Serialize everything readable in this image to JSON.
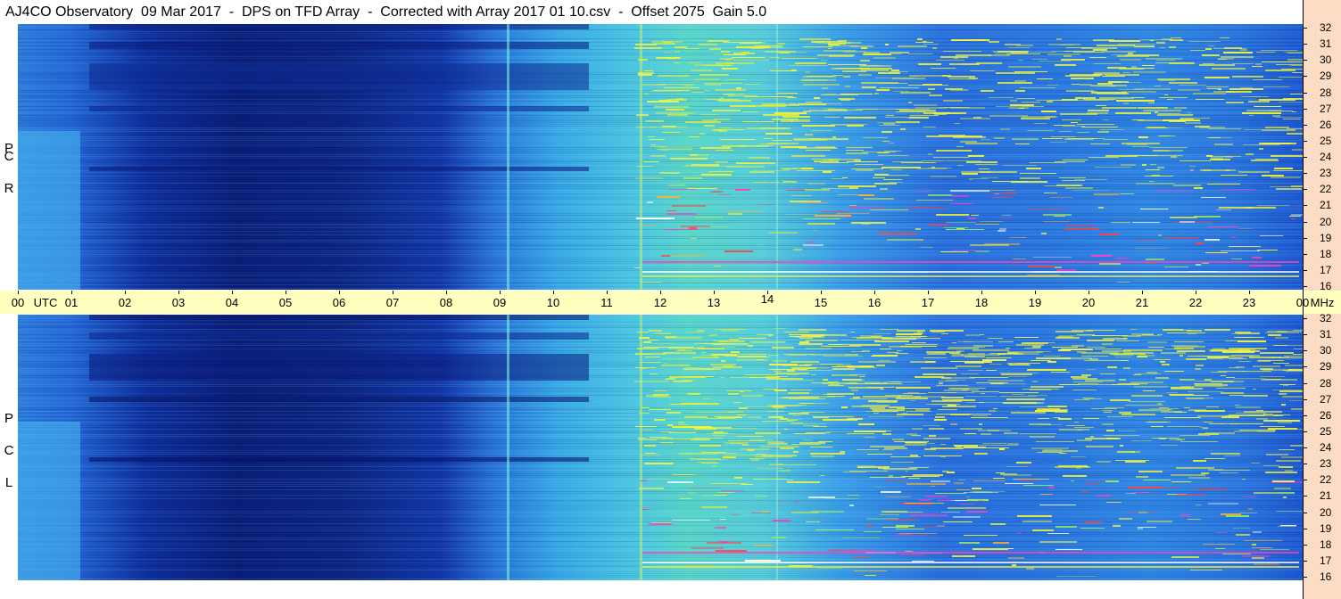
{
  "title": "AJ4CO Observatory  09 Mar 2017  -  DPS on TFD Array  -  Corrected with Array 2017 01 10.csv  -  Offset 2075  Gain 5.0",
  "chart_data": {
    "type": "heatmap",
    "title": "AJ4CO Observatory  09 Mar 2017  -  DPS on TFD Array  -  Corrected with Array 2017 01 10.csv  -  Offset 2075  Gain 5.0",
    "x_unit": "UTC",
    "y_unit": "MHz",
    "x_ticks": [
      "00",
      "01",
      "02",
      "03",
      "04",
      "05",
      "06",
      "07",
      "08",
      "09",
      "10",
      "11",
      "12",
      "13",
      "14",
      "15",
      "16",
      "17",
      "18",
      "19",
      "20",
      "21",
      "22",
      "23",
      "00"
    ],
    "y_ticks": [
      "16",
      "17",
      "18",
      "19",
      "20",
      "21",
      "22",
      "23",
      "24",
      "25",
      "26",
      "27",
      "28",
      "29",
      "30",
      "31",
      "32"
    ],
    "xlim": [
      0,
      24
    ],
    "ylim": [
      16,
      32
    ],
    "panels": [
      {
        "name": "RCP",
        "label_letters": [
          "R",
          "C",
          "P"
        ]
      },
      {
        "name": "LCP",
        "label_letters": [
          "L",
          "C",
          "P"
        ]
      }
    ]
  }
}
